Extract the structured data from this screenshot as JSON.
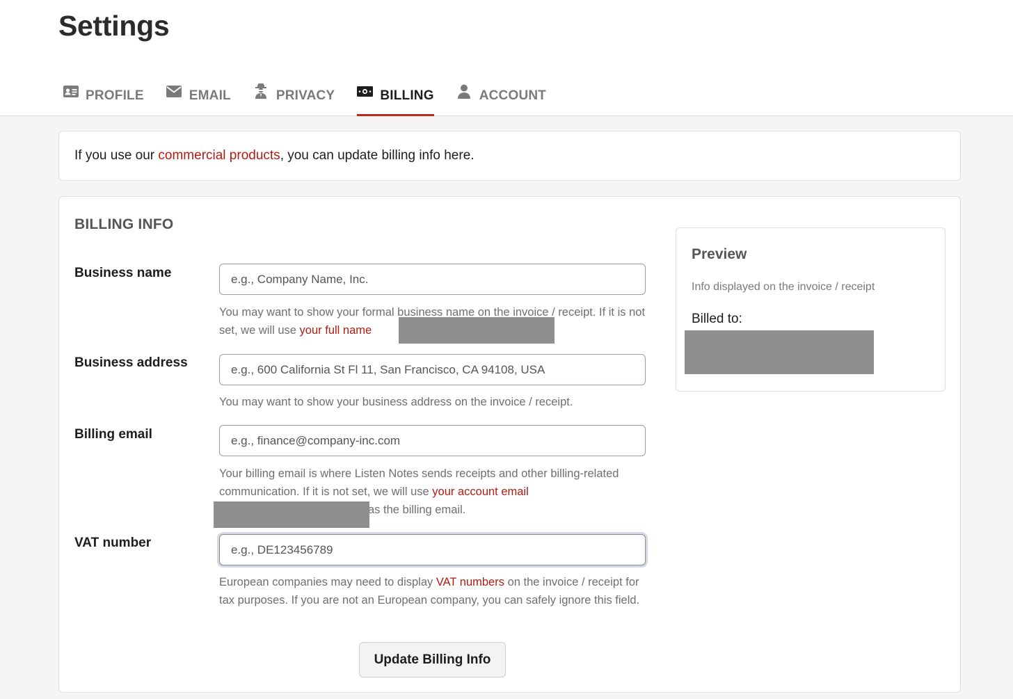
{
  "page": {
    "title": "Settings"
  },
  "tabs": [
    {
      "label": "PROFILE",
      "icon": "id-card-icon"
    },
    {
      "label": "EMAIL",
      "icon": "envelope-icon"
    },
    {
      "label": "PRIVACY",
      "icon": "user-secret-icon"
    },
    {
      "label": "BILLING",
      "icon": "money-bill-icon",
      "active": true
    },
    {
      "label": "ACCOUNT",
      "icon": "user-icon"
    }
  ],
  "notice": {
    "prefix": "If you use our ",
    "link": "commercial products",
    "suffix": ", you can update billing info here."
  },
  "billing": {
    "title": "BILLING INFO",
    "business_name": {
      "label": "Business name",
      "placeholder": "e.g., Company Name, Inc.",
      "help_prefix": "You may want to show your formal business name on the invoice / receipt. If it is not set, we will use ",
      "help_link": "your full name"
    },
    "business_address": {
      "label": "Business address",
      "placeholder": "e.g., 600 California St Fl 11, San Francisco, CA 94108, USA",
      "help": "You may want to show your business address on the invoice / receipt."
    },
    "billing_email": {
      "label": "Billing email",
      "placeholder": "e.g., finance@company-inc.com",
      "help_prefix": "Your billing email is where Listen Notes sends receipts and other billing-related communication. If it is not set, we will use ",
      "help_link": "your account email",
      "help_suffix": "as the billing email."
    },
    "vat_number": {
      "label": "VAT number",
      "placeholder": "e.g., DE123456789",
      "help_prefix": "European companies may need to display ",
      "help_link": "VAT numbers",
      "help_suffix": " on the invoice / receipt for tax purposes. If you are not an European company, you can safely ignore this field."
    },
    "submit_label": "Update Billing Info"
  },
  "preview": {
    "title": "Preview",
    "subtitle": "Info displayed on the invoice / receipt",
    "billed_to": "Billed to:"
  },
  "colors": {
    "accent": "#c0281d",
    "link": "#b31b0f",
    "redaction": "#8e8e8e"
  }
}
